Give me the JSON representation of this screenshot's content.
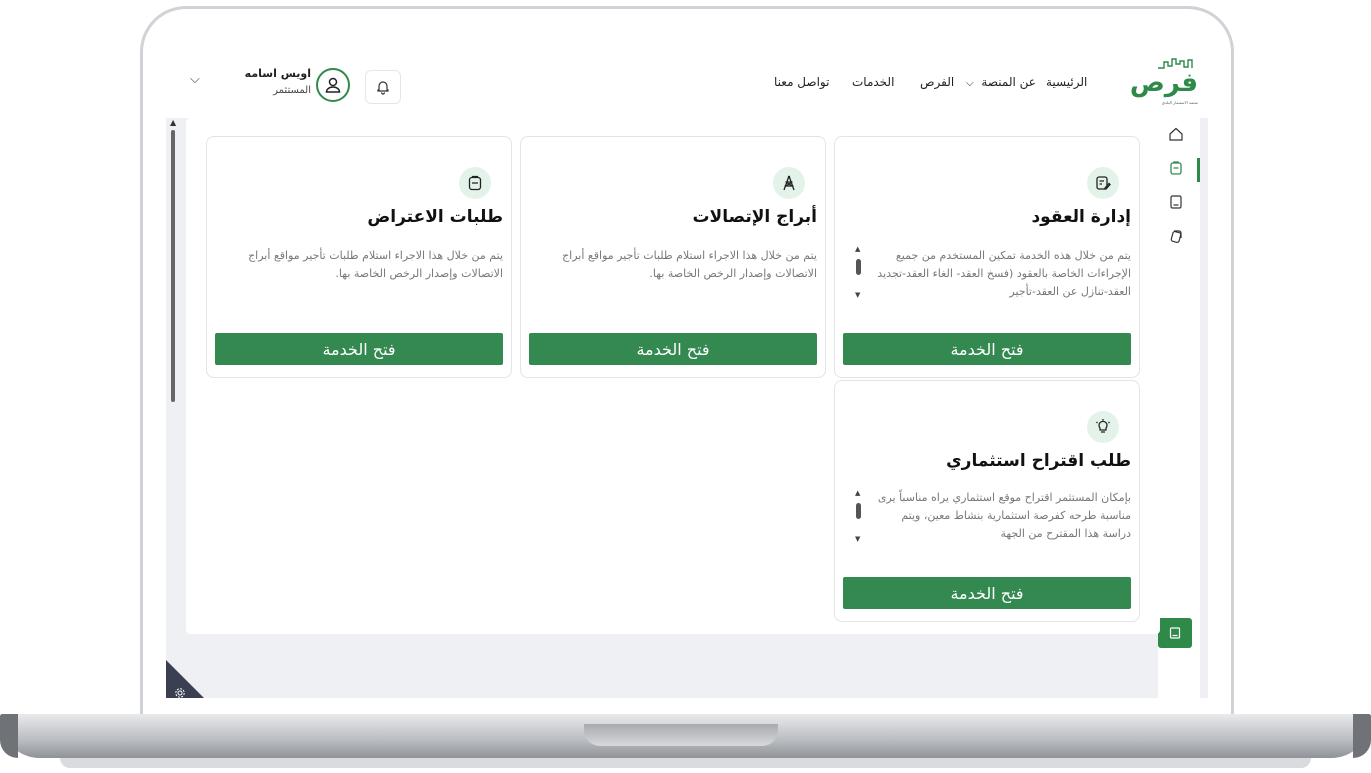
{
  "header": {
    "logo_word": "فرص",
    "logo_tagline": "منصة الاستثمار البلدي",
    "nav": {
      "home": "الرئيسية",
      "about": "عن المنصة",
      "opportunities": "الفرص",
      "services": "الخدمات",
      "contact": "تواصل معنا"
    },
    "user": {
      "name": "اويس اسامه",
      "role": "المستثمر"
    }
  },
  "cards": [
    {
      "title": "إدارة العقود",
      "icon": "contract-edit-icon",
      "description": "يتم من خلال هذه الخدمة تمكين المستخدم من جميع الإجراءات الخاصة بالعقود (فسخ العقد- الغاء العقد-تجديد العقد-تنازل عن العقد-تأجير",
      "button": "فتح الخدمة"
    },
    {
      "title": "أبراج الإتصالات",
      "icon": "telecom-tower-icon",
      "description": "يتم من خلال هذا الاجراء استلام طلبات تأجير مواقع أبراج الاتصالات وإصدار الرخص الخاصة بها.",
      "button": "فتح الخدمة"
    },
    {
      "title": "طلبات الاعتراض",
      "icon": "clipboard-icon",
      "description": "يتم من خلال هذا الاجراء استلام طلبات تأجير مواقع أبراج الاتصالات وإصدار الرخص الخاصة بها.",
      "button": "فتح الخدمة"
    },
    {
      "title": "طلب اقتراح استثماري",
      "icon": "lightbulb-icon",
      "description": "بإمكان المستثمر اقتراح موقع استثماري يراه مناسباً يرى مناسبة طرحه كفرصة استثمارية بنشاط معين، ويتم دراسة هذا المقترح من الجهة",
      "button": "فتح الخدمة"
    }
  ],
  "colors": {
    "brand_green": "#338950",
    "icon_bg": "#e4f3e9",
    "page_bg": "#eef0f3"
  }
}
